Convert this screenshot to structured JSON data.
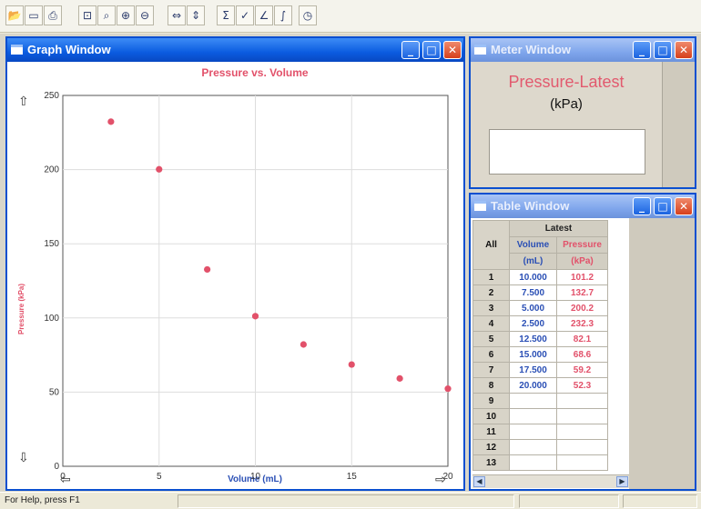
{
  "toolbar": {
    "icons": [
      "open-icon",
      "save-icon",
      "print-icon",
      "zoom-page-icon",
      "zoom-select-icon",
      "zoom-in-icon",
      "zoom-out-icon",
      "autoscale-x-icon",
      "autoscale-y-icon",
      "stats-icon",
      "tangent-icon",
      "fit-icon",
      "integral-icon",
      "timer-icon"
    ]
  },
  "graph_window": {
    "title": "Graph Window",
    "controls": {
      "minimize": "_",
      "maximize": "□",
      "close": "✕"
    }
  },
  "meter_window": {
    "title": "Meter  Window",
    "label": "Pressure-Latest",
    "unit": "(kPa)",
    "value": ""
  },
  "table_window": {
    "title": "Table  Window",
    "all_label": "All",
    "group_header": "Latest",
    "col_volume": "Volume",
    "col_volume_unit": "(mL)",
    "col_pressure": "Pressure",
    "col_pressure_unit": "(kPa)",
    "rows": [
      {
        "n": "1",
        "v": "10.000",
        "p": "101.2"
      },
      {
        "n": "2",
        "v": "7.500",
        "p": "132.7"
      },
      {
        "n": "3",
        "v": "5.000",
        "p": "200.2"
      },
      {
        "n": "4",
        "v": "2.500",
        "p": "232.3"
      },
      {
        "n": "5",
        "v": "12.500",
        "p": "82.1"
      },
      {
        "n": "6",
        "v": "15.000",
        "p": "68.6"
      },
      {
        "n": "7",
        "v": "17.500",
        "p": "59.2"
      },
      {
        "n": "8",
        "v": "20.000",
        "p": "52.3"
      },
      {
        "n": "9",
        "v": "",
        "p": ""
      },
      {
        "n": "10",
        "v": "",
        "p": ""
      },
      {
        "n": "11",
        "v": "",
        "p": ""
      },
      {
        "n": "12",
        "v": "",
        "p": ""
      },
      {
        "n": "13",
        "v": "",
        "p": ""
      }
    ]
  },
  "status_bar": {
    "help_text": "For Help, press F1"
  },
  "colors": {
    "accent": "#0b5ce0",
    "pressure": "#e2516a",
    "volume": "#2a4fb5"
  },
  "chart_data": {
    "type": "scatter",
    "title": "Pressure vs. Volume",
    "xlabel": "Volume (mL)",
    "ylabel": "Pressure (kPa)",
    "xlim": [
      0,
      20
    ],
    "ylim": [
      0,
      250
    ],
    "x_ticks": [
      "0",
      "5",
      "10",
      "15",
      "20"
    ],
    "y_ticks": [
      "0",
      "50",
      "100",
      "150",
      "200",
      "250"
    ],
    "grid": true,
    "series": [
      {
        "x": [
          2.5,
          5,
          7.5,
          10,
          12.5,
          15,
          17.5,
          20
        ],
        "y": [
          232.3,
          200.2,
          132.7,
          101.2,
          82.1,
          68.6,
          59.2,
          52.3
        ]
      }
    ]
  }
}
